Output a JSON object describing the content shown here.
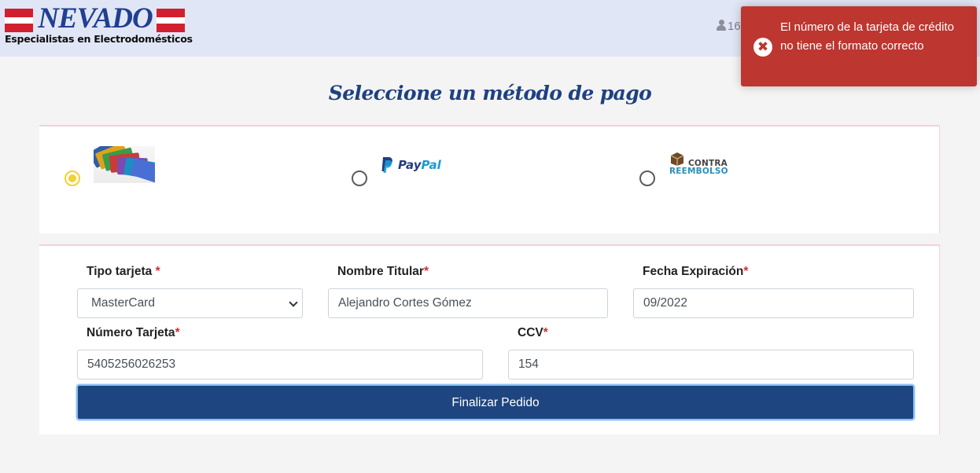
{
  "header": {
    "logo": {
      "brand": "NEVADO",
      "tagline": "Especialistas en Electrodomésticos"
    },
    "user": {
      "icon": "user-icon",
      "text": "16"
    }
  },
  "toast": {
    "icon": "error-circle-x-icon",
    "symbol": "✖",
    "message": "El número de la tarjeta de crédito no tiene el formato correcto",
    "color": "#bd362f"
  },
  "page": {
    "title": "Seleccione un método de pago"
  },
  "payment_methods": {
    "selected": "card",
    "options": [
      {
        "id": "card",
        "icon": "credit-cards-image",
        "selected": true
      },
      {
        "id": "paypal",
        "icon": "paypal-logo",
        "label_part1": "Pay",
        "label_part2": "Pal",
        "selected": false
      },
      {
        "id": "cod",
        "icon": "contra-reembolso-logo",
        "label_line1": "CONTRA",
        "label_line2": "REEMBOLSO",
        "selected": false
      }
    ]
  },
  "form": {
    "card_type": {
      "label": "Tipo tarjeta",
      "required_mark": "*",
      "value": "MasterCard"
    },
    "holder_name": {
      "label": "Nombre Titular",
      "required_mark": "*",
      "value": "Alejandro Cortes Gómez"
    },
    "expiration": {
      "label": "Fecha Expiración",
      "required_mark": "*",
      "value": "09/2022"
    },
    "card_number": {
      "label": "Número Tarjeta",
      "required_mark": "*",
      "value": "5405256026253"
    },
    "ccv": {
      "label": "CCV",
      "required_mark": "*",
      "value": "154"
    },
    "submit_label": "Finalizar Pedido"
  },
  "colors": {
    "brand_blue": "#1e4580",
    "header_bg": "#e1e6f6",
    "radio_selected": "#f5d033",
    "required": "#d32f2f"
  }
}
